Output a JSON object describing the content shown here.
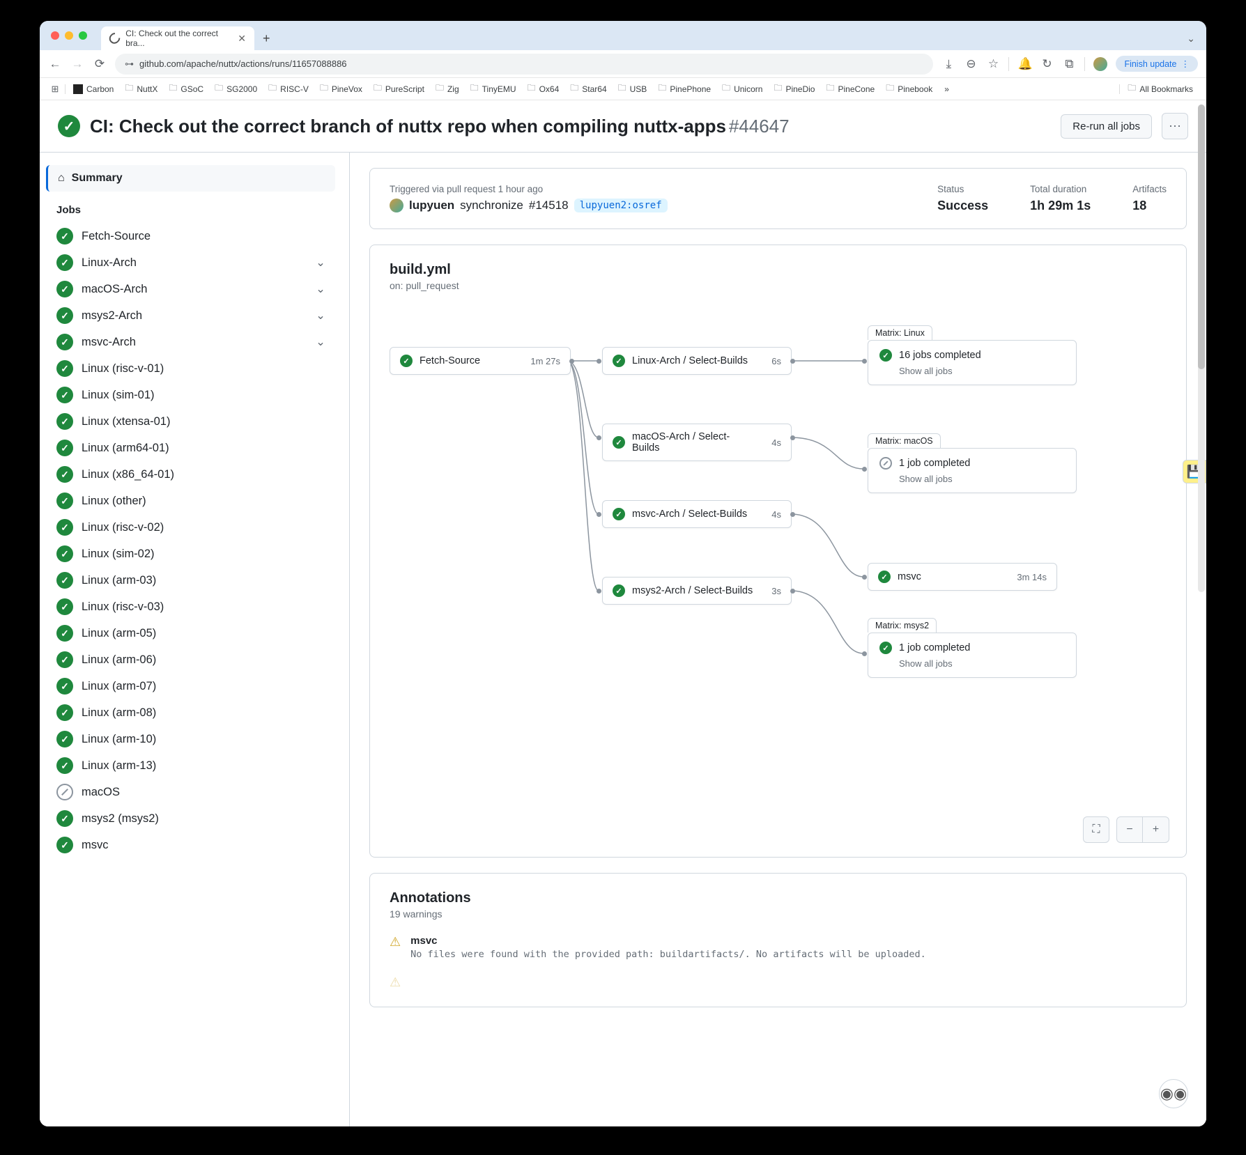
{
  "browser": {
    "tab_title": "CI: Check out the correct bra...",
    "url": "github.com/apache/nuttx/actions/runs/11657088886",
    "update_chip": "Finish update",
    "all_bookmarks": "All Bookmarks",
    "bookmarks": [
      "Carbon",
      "NuttX",
      "GSoC",
      "SG2000",
      "RISC-V",
      "PineVox",
      "PureScript",
      "Zig",
      "TinyEMU",
      "Ox64",
      "Star64",
      "USB",
      "PinePhone",
      "Unicorn",
      "PineDio",
      "PineCone",
      "Pinebook"
    ]
  },
  "header": {
    "title": "CI: Check out the correct branch of nuttx repo when compiling nuttx-apps",
    "run_number": "#44647",
    "rerun_label": "Re-run all jobs"
  },
  "sidebar": {
    "summary_label": "Summary",
    "jobs_label": "Jobs",
    "jobs": [
      {
        "name": "Fetch-Source",
        "status": "success",
        "expandable": false
      },
      {
        "name": "Linux-Arch",
        "status": "success",
        "expandable": true
      },
      {
        "name": "macOS-Arch",
        "status": "success",
        "expandable": true
      },
      {
        "name": "msys2-Arch",
        "status": "success",
        "expandable": true
      },
      {
        "name": "msvc-Arch",
        "status": "success",
        "expandable": true
      },
      {
        "name": "Linux (risc-v-01)",
        "status": "success",
        "expandable": false
      },
      {
        "name": "Linux (sim-01)",
        "status": "success",
        "expandable": false
      },
      {
        "name": "Linux (xtensa-01)",
        "status": "success",
        "expandable": false
      },
      {
        "name": "Linux (arm64-01)",
        "status": "success",
        "expandable": false
      },
      {
        "name": "Linux (x86_64-01)",
        "status": "success",
        "expandable": false
      },
      {
        "name": "Linux (other)",
        "status": "success",
        "expandable": false
      },
      {
        "name": "Linux (risc-v-02)",
        "status": "success",
        "expandable": false
      },
      {
        "name": "Linux (sim-02)",
        "status": "success",
        "expandable": false
      },
      {
        "name": "Linux (arm-03)",
        "status": "success",
        "expandable": false
      },
      {
        "name": "Linux (risc-v-03)",
        "status": "success",
        "expandable": false
      },
      {
        "name": "Linux (arm-05)",
        "status": "success",
        "expandable": false
      },
      {
        "name": "Linux (arm-06)",
        "status": "success",
        "expandable": false
      },
      {
        "name": "Linux (arm-07)",
        "status": "success",
        "expandable": false
      },
      {
        "name": "Linux (arm-08)",
        "status": "success",
        "expandable": false
      },
      {
        "name": "Linux (arm-10)",
        "status": "success",
        "expandable": false
      },
      {
        "name": "Linux (arm-13)",
        "status": "success",
        "expandable": false
      },
      {
        "name": "macOS",
        "status": "skipped",
        "expandable": false
      },
      {
        "name": "msys2 (msys2)",
        "status": "success",
        "expandable": false
      },
      {
        "name": "msvc",
        "status": "success",
        "expandable": false
      }
    ]
  },
  "summary": {
    "trigger_label": "Triggered via pull request 1 hour ago",
    "actor": "lupyuen",
    "action": "synchronize",
    "pr": "#14518",
    "branch": "lupyuen2:osref",
    "status_label": "Status",
    "status_value": "Success",
    "duration_label": "Total duration",
    "duration_value": "1h 29m 1s",
    "artifacts_label": "Artifacts",
    "artifacts_value": "18"
  },
  "workflow": {
    "file": "build.yml",
    "on": "on: pull_request",
    "nodes": {
      "fetch": {
        "label": "Fetch-Source",
        "dur": "1m 27s"
      },
      "linux_arch": {
        "label": "Linux-Arch / Select-Builds",
        "dur": "6s"
      },
      "macos_arch": {
        "label": "macOS-Arch / Select-Builds",
        "dur": "4s"
      },
      "msvc_arch": {
        "label": "msvc-Arch / Select-Builds",
        "dur": "4s"
      },
      "msys2_arch": {
        "label": "msys2-Arch / Select-Builds",
        "dur": "3s"
      },
      "msvc": {
        "label": "msvc",
        "dur": "3m 14s"
      }
    },
    "matrices": {
      "linux": {
        "tab": "Matrix: Linux",
        "line": "16 jobs completed",
        "show": "Show all jobs"
      },
      "macos": {
        "tab": "Matrix: macOS",
        "line": "1 job completed",
        "show": "Show all jobs"
      },
      "msys2": {
        "tab": "Matrix: msys2",
        "line": "1 job completed",
        "show": "Show all jobs"
      }
    }
  },
  "annotations": {
    "title": "Annotations",
    "subtitle": "19 warnings",
    "items": [
      {
        "title": "msvc",
        "desc": "No files were found with the provided path: buildartifacts/. No artifacts will be uploaded."
      }
    ]
  }
}
